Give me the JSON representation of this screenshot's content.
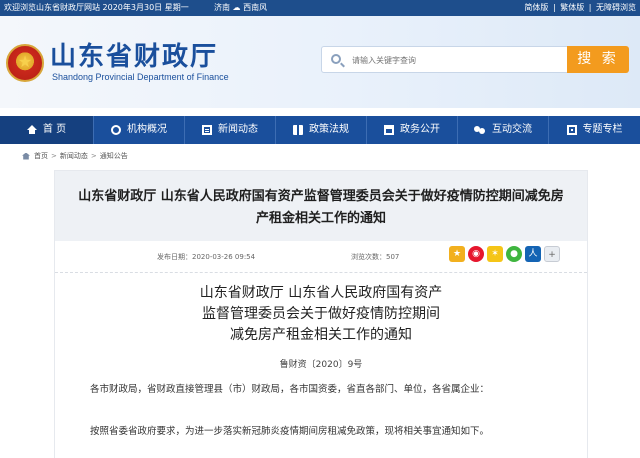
{
  "topbar": {
    "welcome": "欢迎浏览山东省财政厅网站   2020年3月30日 星期一",
    "weather": "济南",
    "weather_detail": "西南风",
    "links": [
      "简体版",
      "繁体版",
      "无障碍浏览"
    ],
    "separator": "|"
  },
  "header": {
    "title": "山东省财政厅",
    "subtitle": "Shandong Provincial Department of Finance",
    "search_placeholder": "请输入关键字查询",
    "search_button": "搜 索"
  },
  "nav": {
    "items": [
      {
        "label": "首  页",
        "icon": "home-icon"
      },
      {
        "label": "机构概况",
        "icon": "organization-icon"
      },
      {
        "label": "新闻动态",
        "icon": "news-icon"
      },
      {
        "label": "政策法规",
        "icon": "book-icon"
      },
      {
        "label": "政务公开",
        "icon": "building-icon"
      },
      {
        "label": "互动交流",
        "icon": "chat-icon"
      },
      {
        "label": "专题专栏",
        "icon": "topic-icon"
      }
    ]
  },
  "breadcrumb": {
    "items": [
      "首页",
      "新闻动态",
      "通知公告"
    ],
    "separator": ">"
  },
  "article": {
    "title": "山东省财政厅 山东省人民政府国有资产监督管理委员会关于做好疫情防控期间减免房产租金相关工作的通知",
    "publish_label": "发布日期：",
    "publish_date": "2020-03-26 09:54",
    "views_label": "浏览次数：",
    "views": "507",
    "share_icons": [
      "star-icon",
      "weibo-icon",
      "qzone-icon",
      "wechat-icon",
      "renren-icon",
      "more-share-icon"
    ],
    "doc_title_lines": [
      "山东省财政厅 山东省人民政府国有资产",
      "监督管理委员会关于做好疫情防控期间",
      "减免房产租金相关工作的通知"
    ],
    "doc_number": "鲁财资〔2020〕9号",
    "paragraphs": [
      "各市财政局，省财政直接管理县（市）财政局，各市国资委，省直各部门、单位，各省属企业：",
      "按照省委省政府要求，为进一步落实新冠肺炎疫情期间房租减免政策，现将相关事宜通知如下。"
    ]
  },
  "colors": {
    "brand_blue": "#1a4f9c",
    "search_orange": "#f39b1e",
    "topbar_blue": "#1e4e8c"
  }
}
